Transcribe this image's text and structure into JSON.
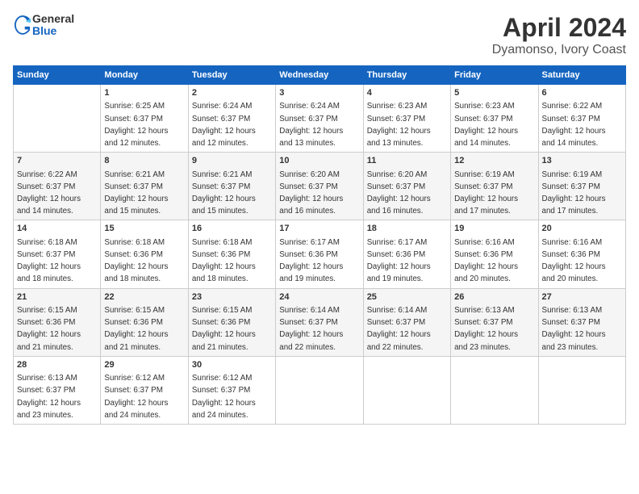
{
  "logo": {
    "general": "General",
    "blue": "Blue"
  },
  "title": "April 2024",
  "subtitle": "Dyamonso, Ivory Coast",
  "days_header": [
    "Sunday",
    "Monday",
    "Tuesday",
    "Wednesday",
    "Thursday",
    "Friday",
    "Saturday"
  ],
  "weeks": [
    [
      {
        "num": "",
        "info": ""
      },
      {
        "num": "1",
        "info": "Sunrise: 6:25 AM\nSunset: 6:37 PM\nDaylight: 12 hours\nand 12 minutes."
      },
      {
        "num": "2",
        "info": "Sunrise: 6:24 AM\nSunset: 6:37 PM\nDaylight: 12 hours\nand 12 minutes."
      },
      {
        "num": "3",
        "info": "Sunrise: 6:24 AM\nSunset: 6:37 PM\nDaylight: 12 hours\nand 13 minutes."
      },
      {
        "num": "4",
        "info": "Sunrise: 6:23 AM\nSunset: 6:37 PM\nDaylight: 12 hours\nand 13 minutes."
      },
      {
        "num": "5",
        "info": "Sunrise: 6:23 AM\nSunset: 6:37 PM\nDaylight: 12 hours\nand 14 minutes."
      },
      {
        "num": "6",
        "info": "Sunrise: 6:22 AM\nSunset: 6:37 PM\nDaylight: 12 hours\nand 14 minutes."
      }
    ],
    [
      {
        "num": "7",
        "info": "Sunrise: 6:22 AM\nSunset: 6:37 PM\nDaylight: 12 hours\nand 14 minutes."
      },
      {
        "num": "8",
        "info": "Sunrise: 6:21 AM\nSunset: 6:37 PM\nDaylight: 12 hours\nand 15 minutes."
      },
      {
        "num": "9",
        "info": "Sunrise: 6:21 AM\nSunset: 6:37 PM\nDaylight: 12 hours\nand 15 minutes."
      },
      {
        "num": "10",
        "info": "Sunrise: 6:20 AM\nSunset: 6:37 PM\nDaylight: 12 hours\nand 16 minutes."
      },
      {
        "num": "11",
        "info": "Sunrise: 6:20 AM\nSunset: 6:37 PM\nDaylight: 12 hours\nand 16 minutes."
      },
      {
        "num": "12",
        "info": "Sunrise: 6:19 AM\nSunset: 6:37 PM\nDaylight: 12 hours\nand 17 minutes."
      },
      {
        "num": "13",
        "info": "Sunrise: 6:19 AM\nSunset: 6:37 PM\nDaylight: 12 hours\nand 17 minutes."
      }
    ],
    [
      {
        "num": "14",
        "info": "Sunrise: 6:18 AM\nSunset: 6:37 PM\nDaylight: 12 hours\nand 18 minutes."
      },
      {
        "num": "15",
        "info": "Sunrise: 6:18 AM\nSunset: 6:36 PM\nDaylight: 12 hours\nand 18 minutes."
      },
      {
        "num": "16",
        "info": "Sunrise: 6:18 AM\nSunset: 6:36 PM\nDaylight: 12 hours\nand 18 minutes."
      },
      {
        "num": "17",
        "info": "Sunrise: 6:17 AM\nSunset: 6:36 PM\nDaylight: 12 hours\nand 19 minutes."
      },
      {
        "num": "18",
        "info": "Sunrise: 6:17 AM\nSunset: 6:36 PM\nDaylight: 12 hours\nand 19 minutes."
      },
      {
        "num": "19",
        "info": "Sunrise: 6:16 AM\nSunset: 6:36 PM\nDaylight: 12 hours\nand 20 minutes."
      },
      {
        "num": "20",
        "info": "Sunrise: 6:16 AM\nSunset: 6:36 PM\nDaylight: 12 hours\nand 20 minutes."
      }
    ],
    [
      {
        "num": "21",
        "info": "Sunrise: 6:15 AM\nSunset: 6:36 PM\nDaylight: 12 hours\nand 21 minutes."
      },
      {
        "num": "22",
        "info": "Sunrise: 6:15 AM\nSunset: 6:36 PM\nDaylight: 12 hours\nand 21 minutes."
      },
      {
        "num": "23",
        "info": "Sunrise: 6:15 AM\nSunset: 6:36 PM\nDaylight: 12 hours\nand 21 minutes."
      },
      {
        "num": "24",
        "info": "Sunrise: 6:14 AM\nSunset: 6:37 PM\nDaylight: 12 hours\nand 22 minutes."
      },
      {
        "num": "25",
        "info": "Sunrise: 6:14 AM\nSunset: 6:37 PM\nDaylight: 12 hours\nand 22 minutes."
      },
      {
        "num": "26",
        "info": "Sunrise: 6:13 AM\nSunset: 6:37 PM\nDaylight: 12 hours\nand 23 minutes."
      },
      {
        "num": "27",
        "info": "Sunrise: 6:13 AM\nSunset: 6:37 PM\nDaylight: 12 hours\nand 23 minutes."
      }
    ],
    [
      {
        "num": "28",
        "info": "Sunrise: 6:13 AM\nSunset: 6:37 PM\nDaylight: 12 hours\nand 23 minutes."
      },
      {
        "num": "29",
        "info": "Sunrise: 6:12 AM\nSunset: 6:37 PM\nDaylight: 12 hours\nand 24 minutes."
      },
      {
        "num": "30",
        "info": "Sunrise: 6:12 AM\nSunset: 6:37 PM\nDaylight: 12 hours\nand 24 minutes."
      },
      {
        "num": "",
        "info": ""
      },
      {
        "num": "",
        "info": ""
      },
      {
        "num": "",
        "info": ""
      },
      {
        "num": "",
        "info": ""
      }
    ]
  ]
}
